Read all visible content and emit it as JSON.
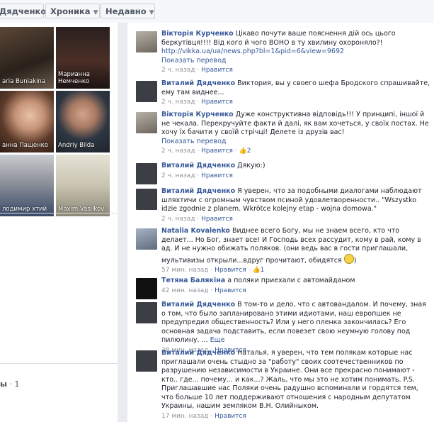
{
  "topbar": {
    "name": "Дядченко",
    "timeline": "Хроника",
    "recent": "Недавно"
  },
  "friends": [
    {
      "name": "aria Buniakina"
    },
    {
      "name": "Марианна Немченко"
    },
    {
      "name": "анна Пащенко"
    },
    {
      "name": "Andriy Bilda"
    },
    {
      "name": "лодимир хтий"
    },
    {
      "name": "Maxim Vasilkov"
    }
  ],
  "left_footer": {
    "label": "ы",
    "count": "· 1"
  },
  "comments": [
    {
      "author": "Вікторія Курченко",
      "text": " Цікаво почути ваше пояснення дій ось цього беркутівця!!!! Від кого й чого ВОНО в ту хвилину охороняло?!",
      "link": "http://vikka.ua/ua/news.php?bl=1&pid=6&view=9692",
      "translate": "Показать перевод",
      "time": "2 ч. назад",
      "like": "Нравится",
      "likes": ""
    },
    {
      "author": "Виталий Дядченко",
      "text": " Виктория, вы у своего шефа Бродского спрашивайте, ему там виднее...",
      "time": "2 ч. назад",
      "like": "Нравится",
      "likes": ""
    },
    {
      "author": "Вікторія Курченко",
      "text": " Дуже конструктивна відповідь!!! У принципі, іншої й не чекала. Перекручуйте факти й далі, як вам хочеться, у своїх постах. Не хочу їх бачити у своїй стрічці! Делете із друзів вас!",
      "translate": "Показать перевод",
      "time": "2 ч. назад",
      "like": "Нравится",
      "likes": "2"
    },
    {
      "author": "Виталий Дядченко",
      "text": " Дякую:)",
      "time": "2 ч. назад",
      "like": "Нравится",
      "likes": ""
    },
    {
      "author": "Виталий Дядченко",
      "text": " Я уверен, что за подобными диалогами наблюдают шляхтичи с огромным чувством псиной удовлетворенности.. \"Wszystko idzie zgodnie z planem. Wkrótce kolejny etap - wojna domowa.\"",
      "time": "2 ч. назад",
      "like": "Нравится",
      "likes": ""
    },
    {
      "author": "Natalia Kovalenko",
      "text": " Виднее всего Богу, мы не знаем всего, кто что делает... Но Бог, знает все! И Господь всех рассудит, кому в рай, кому в ад. И не нужно обижать поляков. (они ведь вас в гости приглашали, мультивизы открыли...вдруг прочитают, обидятся ",
      "time": "57 мин. назад",
      "like": "Нравится",
      "likes": "1"
    },
    {
      "author": "Тетяна Балякіна",
      "text": " а поляки приехали с автомайданом",
      "time": "42 мин. назад",
      "like": "Нравится",
      "likes": ""
    },
    {
      "author": "Виталий Дядченко",
      "text": " В том-то и дело, что с автовандалом. И почему, зная о том, что было запланировано этими идиотами, наш европшек не предупредил общественность? Или у него пленка закончилась? Его основная задача подставить, если повезет свою неумную голову под пилюлину. ...",
      "more": "Еще",
      "time": "28 мин. назад",
      "like": "Нравится",
      "likes": ""
    },
    {
      "author": "Виталий Дядченко",
      "text": " Наталья, я уверен, что тем полякам которые нас приглашали очень стыдно за \"работу\" своих соотечественников по разрушению независимости в Украине. Они все прекрасно понимают - кто.. где... почему... и как...? Жаль, что мы это не хотим понимать. P.S. Приглашавшие нас Поляки очень радушно вспоминали и гордятся тем, что больше 10 лет поддерживают отношения с народным депутатом Украины, нашим земляком В.Н. Олийныком.",
      "time": "17 мин. назад",
      "like": "Нравится",
      "likes": ""
    }
  ]
}
